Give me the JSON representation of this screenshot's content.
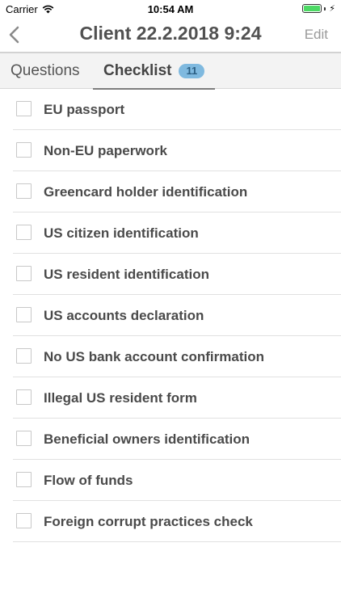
{
  "status_bar": {
    "carrier": "Carrier",
    "time": "10:54 AM",
    "battery_level": 1.0
  },
  "nav": {
    "title": "Client 22.2.2018 9:24",
    "edit_label": "Edit",
    "back_icon": "chevron-left-icon"
  },
  "tabs": {
    "questions_label": "Questions",
    "checklist_label": "Checklist",
    "checklist_badge": "11",
    "active": "checklist"
  },
  "checklist": {
    "items": [
      {
        "label": "EU passport",
        "checked": false
      },
      {
        "label": "Non-EU paperwork",
        "checked": false
      },
      {
        "label": "Greencard holder identification",
        "checked": false
      },
      {
        "label": "US citizen identification",
        "checked": false
      },
      {
        "label": "US resident identification",
        "checked": false
      },
      {
        "label": "US accounts declaration",
        "checked": false
      },
      {
        "label": "No US bank account confirmation",
        "checked": false
      },
      {
        "label": "Illegal US resident form",
        "checked": false
      },
      {
        "label": "Beneficial owners identification",
        "checked": false
      },
      {
        "label": "Flow of funds",
        "checked": false
      },
      {
        "label": "Foreign corrupt practices check",
        "checked": false
      }
    ]
  },
  "colors": {
    "badge_bg": "#7fb9df",
    "tab_bar_bg": "#f3f3f3",
    "title_text": "#515151"
  }
}
